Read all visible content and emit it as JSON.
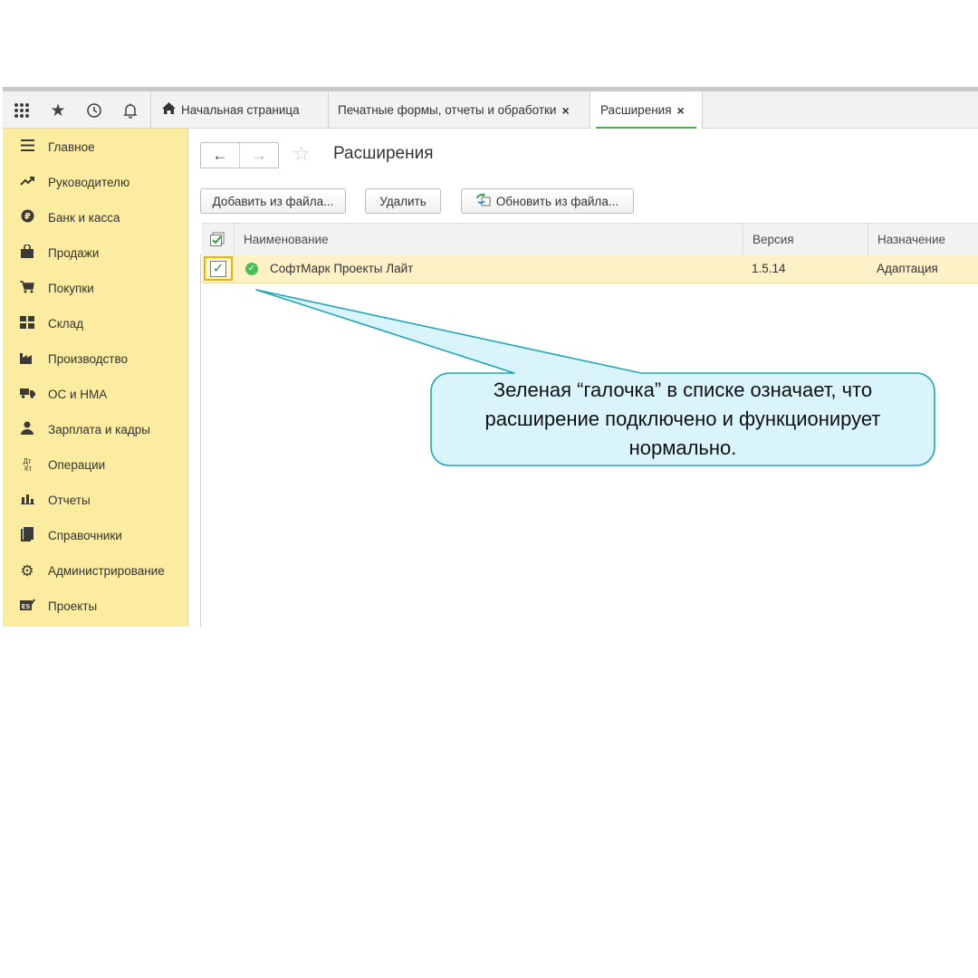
{
  "topbar": {
    "icons": [
      "apps-grid-icon",
      "favorites-star-icon",
      "history-icon",
      "notifications-bell-icon"
    ],
    "tabs": [
      {
        "label": "Начальная страница",
        "icon": "home-icon"
      },
      {
        "label": "Печатные формы, отчеты и обработки",
        "close": "×"
      },
      {
        "label": "Расширения",
        "close": "×",
        "active": true
      }
    ]
  },
  "sidebar": {
    "items": [
      {
        "label": "Главное",
        "icon": "menu-lines-icon"
      },
      {
        "label": "Руководителю",
        "icon": "trend-chart-icon"
      },
      {
        "label": "Банк и касса",
        "icon": "ruble-coin-icon"
      },
      {
        "label": "Продажи",
        "icon": "shopping-bag-icon"
      },
      {
        "label": "Покупки",
        "icon": "shopping-cart-icon"
      },
      {
        "label": "Склад",
        "icon": "warehouse-grid-icon"
      },
      {
        "label": "Производство",
        "icon": "factory-icon"
      },
      {
        "label": "ОС и НМА",
        "icon": "truck-icon"
      },
      {
        "label": "Зарплата и кадры",
        "icon": "person-icon"
      },
      {
        "label": "Операции",
        "icon": "dt-kt-icon",
        "icon_text": "Дт Кт"
      },
      {
        "label": "Отчеты",
        "icon": "bar-chart-icon"
      },
      {
        "label": "Справочники",
        "icon": "books-icon"
      },
      {
        "label": "Администрирование",
        "icon": "gear-icon"
      },
      {
        "label": "Проекты",
        "icon": "projects-icon"
      }
    ]
  },
  "main": {
    "title": "Расширения",
    "nav": {
      "back": "←",
      "forward": "→"
    },
    "buttons": {
      "add_from_file": "Добавить из файла...",
      "delete": "Удалить",
      "update_from_file": "Обновить из файла..."
    },
    "table": {
      "columns": [
        "Наименование",
        "Версия",
        "Назначение"
      ],
      "rows": [
        {
          "checked": true,
          "status": "active",
          "name": "СофтМарк Проекты Лайт",
          "version": "1.5.14",
          "purpose": "Адаптация"
        }
      ]
    }
  },
  "callout": {
    "line1": "Зеленая “галочка” в списке означает, что",
    "line2": "расширение подключено и функционирует",
    "line3": "нормально.",
    "fill_color": "#d9f5fb",
    "border_color": "#1fa6b8"
  }
}
